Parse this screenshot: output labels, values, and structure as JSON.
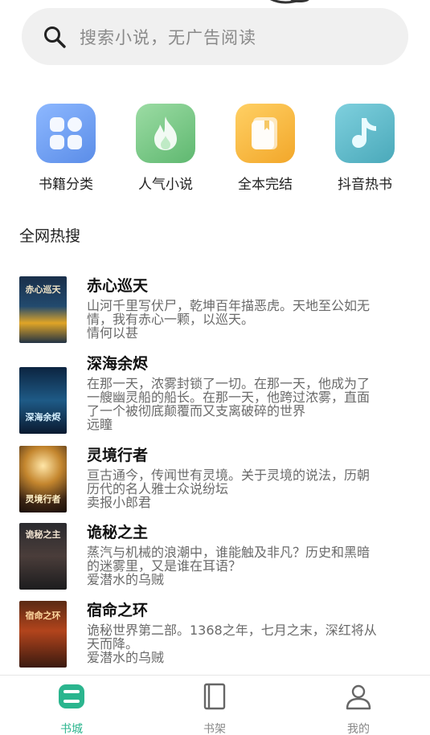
{
  "search": {
    "placeholder": "搜索小说，无广告阅读",
    "icon": "search-icon"
  },
  "categories": [
    {
      "label": "书籍分类",
      "icon": "grid-icon",
      "color": "#6f9cf0"
    },
    {
      "label": "人气小说",
      "icon": "flame-icon",
      "color": "#77c787"
    },
    {
      "label": "全本完结",
      "icon": "book-icon",
      "color": "#f5b73a"
    },
    {
      "label": "抖音热书",
      "icon": "music-note-icon",
      "color": "#5fb9c9"
    }
  ],
  "section": {
    "title": "全网热搜"
  },
  "books": [
    {
      "title": "赤心巡天",
      "desc1": "山河千里写伏尸，乾坤百年描恶虎。天地至公如无",
      "desc2": "情，我有赤心一颗，以巡天。",
      "author": "情何以甚",
      "cover_text": "赤心巡天"
    },
    {
      "title": "深海余烬",
      "desc1": "在那一天，浓雾封锁了一切。在那一天，他成为了",
      "desc2": "一艘幽灵船的船长。在那一天，他跨过浓雾，直面",
      "desc3": "了一个被彻底颠覆而又支离破碎的世界",
      "author": "远瞳",
      "cover_text": "深海余烬"
    },
    {
      "title": "灵境行者",
      "desc1": "亘古通今，传闻世有灵境。关于灵境的说法，历朝",
      "desc2": "历代的名人雅士众说纷坛",
      "author": "卖报小郎君",
      "cover_text": "灵境行者"
    },
    {
      "title": "诡秘之主",
      "desc1": "蒸汽与机械的浪潮中，谁能触及非凡？历史和黑暗",
      "desc2": "的迷雾里，又是谁在耳语？",
      "author": "爱潜水的乌贼",
      "cover_text": "诡秘之主"
    },
    {
      "title": "宿命之环",
      "desc1": "诡秘世界第二部。1368之年，七月之末，深红将从",
      "desc2": "天而降。",
      "author": "爱潜水的乌贼",
      "cover_text": "宿命之环"
    }
  ],
  "tabbar": [
    {
      "label": "书城",
      "icon": "bookstore-icon",
      "active": true
    },
    {
      "label": "书架",
      "icon": "bookshelf-icon",
      "active": false
    },
    {
      "label": "我的",
      "icon": "user-icon",
      "active": false
    }
  ],
  "colors": {
    "accent": "#2bb58e",
    "text_secondary": "#6a6a6a",
    "search_bg": "#f0f0f0"
  }
}
